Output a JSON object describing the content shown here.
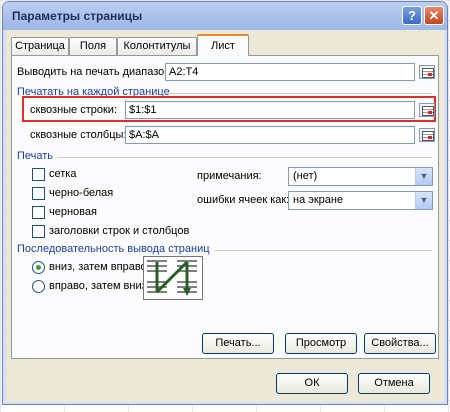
{
  "window": {
    "title": "Параметры страницы",
    "help_symbol": "?",
    "close_symbol": "✕"
  },
  "tabs": [
    {
      "label": "Страница",
      "active": false
    },
    {
      "label": "Поля",
      "active": false
    },
    {
      "label": "Колонтитулы",
      "active": false
    },
    {
      "label": "Лист",
      "active": true
    }
  ],
  "print_area": {
    "label": "Выводить на печать диапазон:",
    "value": "A2:T4"
  },
  "print_titles": {
    "section_label": "Печатать на каждой странице",
    "rows_label": "сквозные строки:",
    "rows_value": "$1:$1",
    "cols_label": "сквозные столбцы:",
    "cols_value": "$A:$A"
  },
  "print": {
    "section_label": "Печать",
    "checkboxes": [
      {
        "label": "сетка",
        "checked": false
      },
      {
        "label": "черно-белая",
        "checked": false
      },
      {
        "label": "черновая",
        "checked": false
      },
      {
        "label": "заголовки строк и столбцов",
        "checked": false
      }
    ],
    "comments_label": "примечания:",
    "comments_value": "(нет)",
    "errors_label": "ошибки ячеек как:",
    "errors_value": "на экране"
  },
  "page_order": {
    "section_label": "Последовательность вывода страниц",
    "options": [
      {
        "label": "вниз, затем вправо",
        "selected": true
      },
      {
        "label": "вправо, затем вниз",
        "selected": false
      }
    ]
  },
  "buttons": {
    "print": "Печать...",
    "preview": "Просмотр",
    "properties": "Свойства...",
    "ok": "ОК",
    "cancel": "Отмена"
  },
  "colors": {
    "accent": "#1b3fa1",
    "highlight": "#d9302b",
    "dialog_bg": "#ece9d8"
  }
}
